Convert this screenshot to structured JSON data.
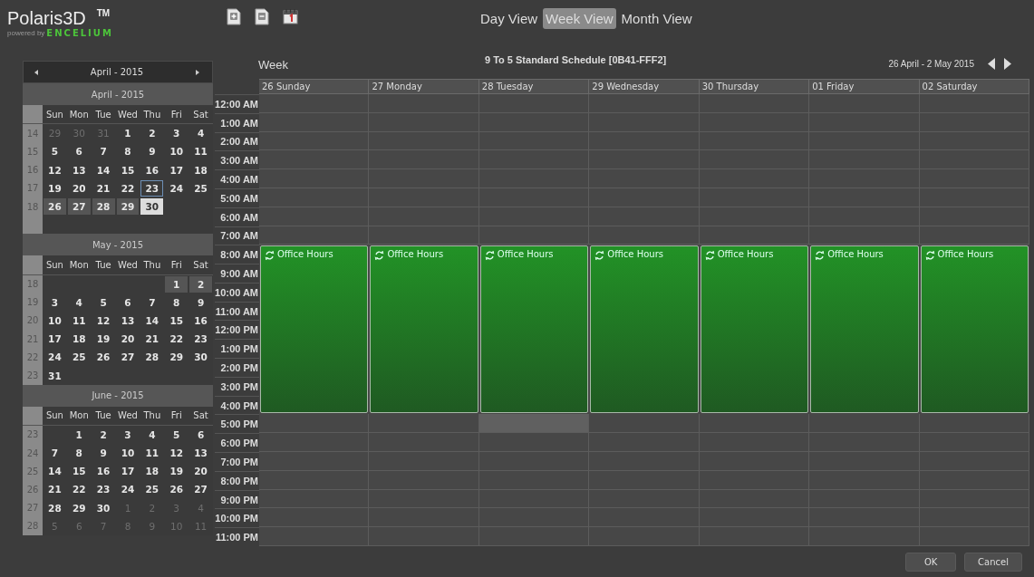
{
  "app": {
    "name": "Polaris3D",
    "trademark": "TM",
    "powered_by": "powered by",
    "brand": "ENCELIUM"
  },
  "views": [
    {
      "label": "Day View",
      "selected": false
    },
    {
      "label": "Week View",
      "selected": true
    },
    {
      "label": "Month View",
      "selected": false
    }
  ],
  "mini_calendar": {
    "title": "April - 2015",
    "months": [
      {
        "title": "April - 2015",
        "weekdays": [
          "Sun",
          "Mon",
          "Tue",
          "Wed",
          "Thu",
          "Fri",
          "Sat"
        ],
        "weeks": [
          {
            "number": "14",
            "days": [
              {
                "day": "29",
                "kind": "other"
              },
              {
                "day": "30",
                "kind": "other"
              },
              {
                "day": "31",
                "kind": "other"
              },
              {
                "day": "1",
                "kind": "normal"
              },
              {
                "day": "2",
                "kind": "normal"
              },
              {
                "day": "3",
                "kind": "normal"
              },
              {
                "day": "4",
                "kind": "normal"
              }
            ]
          },
          {
            "number": "15",
            "days": [
              {
                "day": "5",
                "kind": "normal"
              },
              {
                "day": "6",
                "kind": "normal"
              },
              {
                "day": "7",
                "kind": "normal"
              },
              {
                "day": "8",
                "kind": "normal"
              },
              {
                "day": "9",
                "kind": "normal"
              },
              {
                "day": "10",
                "kind": "normal"
              },
              {
                "day": "11",
                "kind": "normal"
              }
            ]
          },
          {
            "number": "16",
            "days": [
              {
                "day": "12",
                "kind": "normal"
              },
              {
                "day": "13",
                "kind": "normal"
              },
              {
                "day": "14",
                "kind": "normal"
              },
              {
                "day": "15",
                "kind": "normal"
              },
              {
                "day": "16",
                "kind": "normal"
              },
              {
                "day": "17",
                "kind": "normal"
              },
              {
                "day": "18",
                "kind": "normal"
              }
            ]
          },
          {
            "number": "17",
            "days": [
              {
                "day": "19",
                "kind": "normal"
              },
              {
                "day": "20",
                "kind": "normal"
              },
              {
                "day": "21",
                "kind": "normal"
              },
              {
                "day": "22",
                "kind": "normal"
              },
              {
                "day": "23",
                "kind": "today"
              },
              {
                "day": "24",
                "kind": "normal"
              },
              {
                "day": "25",
                "kind": "normal"
              }
            ]
          },
          {
            "number": "18",
            "days": [
              {
                "day": "26",
                "kind": "week"
              },
              {
                "day": "27",
                "kind": "week"
              },
              {
                "day": "28",
                "kind": "week"
              },
              {
                "day": "29",
                "kind": "week"
              },
              {
                "day": "30",
                "kind": "selected"
              },
              {
                "kind": "blank"
              },
              {
                "kind": "blank"
              }
            ]
          }
        ]
      },
      {
        "title": "May - 2015",
        "weekdays": [
          "Sun",
          "Mon",
          "Tue",
          "Wed",
          "Thu",
          "Fri",
          "Sat"
        ],
        "weeks": [
          {
            "number": "18",
            "days": [
              {
                "kind": "blank"
              },
              {
                "kind": "blank"
              },
              {
                "kind": "blank"
              },
              {
                "kind": "blank"
              },
              {
                "kind": "blank"
              },
              {
                "day": "1",
                "kind": "week"
              },
              {
                "day": "2",
                "kind": "week"
              }
            ]
          },
          {
            "number": "19",
            "days": [
              {
                "day": "3",
                "kind": "normal"
              },
              {
                "day": "4",
                "kind": "normal"
              },
              {
                "day": "5",
                "kind": "normal"
              },
              {
                "day": "6",
                "kind": "normal"
              },
              {
                "day": "7",
                "kind": "normal"
              },
              {
                "day": "8",
                "kind": "normal"
              },
              {
                "day": "9",
                "kind": "normal"
              }
            ]
          },
          {
            "number": "20",
            "days": [
              {
                "day": "10",
                "kind": "normal"
              },
              {
                "day": "11",
                "kind": "normal"
              },
              {
                "day": "12",
                "kind": "normal"
              },
              {
                "day": "13",
                "kind": "normal"
              },
              {
                "day": "14",
                "kind": "normal"
              },
              {
                "day": "15",
                "kind": "normal"
              },
              {
                "day": "16",
                "kind": "normal"
              }
            ]
          },
          {
            "number": "21",
            "days": [
              {
                "day": "17",
                "kind": "normal"
              },
              {
                "day": "18",
                "kind": "normal"
              },
              {
                "day": "19",
                "kind": "normal"
              },
              {
                "day": "20",
                "kind": "normal"
              },
              {
                "day": "21",
                "kind": "normal"
              },
              {
                "day": "22",
                "kind": "normal"
              },
              {
                "day": "23",
                "kind": "normal"
              }
            ]
          },
          {
            "number": "22",
            "days": [
              {
                "day": "24",
                "kind": "normal"
              },
              {
                "day": "25",
                "kind": "normal"
              },
              {
                "day": "26",
                "kind": "normal"
              },
              {
                "day": "27",
                "kind": "normal"
              },
              {
                "day": "28",
                "kind": "normal"
              },
              {
                "day": "29",
                "kind": "normal"
              },
              {
                "day": "30",
                "kind": "normal"
              }
            ]
          },
          {
            "number": "23",
            "days": [
              {
                "day": "31",
                "kind": "normal"
              },
              {
                "kind": "blank"
              },
              {
                "kind": "blank"
              },
              {
                "kind": "blank"
              },
              {
                "kind": "blank"
              },
              {
                "kind": "blank"
              },
              {
                "kind": "blank"
              }
            ]
          }
        ]
      },
      {
        "title": "June - 2015",
        "weekdays": [
          "Sun",
          "Mon",
          "Tue",
          "Wed",
          "Thu",
          "Fri",
          "Sat"
        ],
        "weeks": [
          {
            "number": "23",
            "days": [
              {
                "kind": "blank"
              },
              {
                "day": "1",
                "kind": "normal"
              },
              {
                "day": "2",
                "kind": "normal"
              },
              {
                "day": "3",
                "kind": "normal"
              },
              {
                "day": "4",
                "kind": "normal"
              },
              {
                "day": "5",
                "kind": "normal"
              },
              {
                "day": "6",
                "kind": "normal"
              }
            ]
          },
          {
            "number": "24",
            "days": [
              {
                "day": "7",
                "kind": "normal"
              },
              {
                "day": "8",
                "kind": "normal"
              },
              {
                "day": "9",
                "kind": "normal"
              },
              {
                "day": "10",
                "kind": "normal"
              },
              {
                "day": "11",
                "kind": "normal"
              },
              {
                "day": "12",
                "kind": "normal"
              },
              {
                "day": "13",
                "kind": "normal"
              }
            ]
          },
          {
            "number": "25",
            "days": [
              {
                "day": "14",
                "kind": "normal"
              },
              {
                "day": "15",
                "kind": "normal"
              },
              {
                "day": "16",
                "kind": "normal"
              },
              {
                "day": "17",
                "kind": "normal"
              },
              {
                "day": "18",
                "kind": "normal"
              },
              {
                "day": "19",
                "kind": "normal"
              },
              {
                "day": "20",
                "kind": "normal"
              }
            ]
          },
          {
            "number": "26",
            "days": [
              {
                "day": "21",
                "kind": "normal"
              },
              {
                "day": "22",
                "kind": "normal"
              },
              {
                "day": "23",
                "kind": "normal"
              },
              {
                "day": "24",
                "kind": "normal"
              },
              {
                "day": "25",
                "kind": "normal"
              },
              {
                "day": "26",
                "kind": "normal"
              },
              {
                "day": "27",
                "kind": "normal"
              }
            ]
          },
          {
            "number": "27",
            "days": [
              {
                "day": "28",
                "kind": "normal"
              },
              {
                "day": "29",
                "kind": "normal"
              },
              {
                "day": "30",
                "kind": "normal"
              },
              {
                "day": "1",
                "kind": "other"
              },
              {
                "day": "2",
                "kind": "other"
              },
              {
                "day": "3",
                "kind": "other"
              },
              {
                "day": "4",
                "kind": "other"
              }
            ]
          },
          {
            "number": "28",
            "days": [
              {
                "day": "5",
                "kind": "other"
              },
              {
                "day": "6",
                "kind": "other"
              },
              {
                "day": "7",
                "kind": "other"
              },
              {
                "day": "8",
                "kind": "other"
              },
              {
                "day": "9",
                "kind": "other"
              },
              {
                "day": "10",
                "kind": "other"
              },
              {
                "day": "11",
                "kind": "other"
              }
            ]
          }
        ]
      }
    ]
  },
  "schedule": {
    "view_label": "Week",
    "title": "9 To 5 Standard Schedule [0B41-FFF2]",
    "date_range": "26 April - 2 May 2015",
    "hours": [
      "12:00 AM",
      "1:00 AM",
      "2:00 AM",
      "3:00 AM",
      "4:00 AM",
      "5:00 AM",
      "6:00 AM",
      "7:00 AM",
      "8:00 AM",
      "9:00 AM",
      "10:00 AM",
      "11:00 AM",
      "12:00 PM",
      "1:00 PM",
      "2:00 PM",
      "3:00 PM",
      "4:00 PM",
      "5:00 PM",
      "6:00 PM",
      "7:00 PM",
      "8:00 PM",
      "9:00 PM",
      "10:00 PM",
      "11:00 PM"
    ],
    "days": [
      {
        "label": "26 Sunday",
        "event": {
          "title": "Office Hours"
        },
        "slots": [
          {
            "kind": "free"
          },
          {
            "kind": "free"
          },
          {
            "kind": "free"
          },
          {
            "kind": "free"
          },
          {
            "kind": "free"
          },
          {
            "kind": "free"
          },
          {
            "kind": "free"
          },
          {
            "kind": "free"
          },
          {
            "kind": "event"
          },
          {
            "kind": "event"
          },
          {
            "kind": "event"
          },
          {
            "kind": "event"
          },
          {
            "kind": "event"
          },
          {
            "kind": "event"
          },
          {
            "kind": "event"
          },
          {
            "kind": "event"
          },
          {
            "kind": "event"
          },
          {
            "kind": "free"
          },
          {
            "kind": "free"
          },
          {
            "kind": "free"
          },
          {
            "kind": "free"
          },
          {
            "kind": "free"
          },
          {
            "kind": "free"
          },
          {
            "kind": "free"
          }
        ]
      },
      {
        "label": "27 Monday",
        "event": {
          "title": "Office Hours"
        },
        "slots": [
          {
            "kind": "free"
          },
          {
            "kind": "free"
          },
          {
            "kind": "free"
          },
          {
            "kind": "free"
          },
          {
            "kind": "free"
          },
          {
            "kind": "free"
          },
          {
            "kind": "free"
          },
          {
            "kind": "free"
          },
          {
            "kind": "event"
          },
          {
            "kind": "event"
          },
          {
            "kind": "event"
          },
          {
            "kind": "event"
          },
          {
            "kind": "event"
          },
          {
            "kind": "event"
          },
          {
            "kind": "event"
          },
          {
            "kind": "event"
          },
          {
            "kind": "event"
          },
          {
            "kind": "free"
          },
          {
            "kind": "free"
          },
          {
            "kind": "free"
          },
          {
            "kind": "free"
          },
          {
            "kind": "free"
          },
          {
            "kind": "free"
          },
          {
            "kind": "free"
          }
        ]
      },
      {
        "label": "28 Tuesday",
        "event": {
          "title": "Office Hours"
        },
        "slots": [
          {
            "kind": "free"
          },
          {
            "kind": "free"
          },
          {
            "kind": "free"
          },
          {
            "kind": "free"
          },
          {
            "kind": "free"
          },
          {
            "kind": "free"
          },
          {
            "kind": "free"
          },
          {
            "kind": "free"
          },
          {
            "kind": "event"
          },
          {
            "kind": "event"
          },
          {
            "kind": "event"
          },
          {
            "kind": "event"
          },
          {
            "kind": "event"
          },
          {
            "kind": "event"
          },
          {
            "kind": "event"
          },
          {
            "kind": "event"
          },
          {
            "kind": "event"
          },
          {
            "kind": "selected"
          },
          {
            "kind": "free"
          },
          {
            "kind": "free"
          },
          {
            "kind": "free"
          },
          {
            "kind": "free"
          },
          {
            "kind": "free"
          },
          {
            "kind": "free"
          }
        ]
      },
      {
        "label": "29 Wednesday",
        "event": {
          "title": "Office Hours"
        },
        "slots": [
          {
            "kind": "free"
          },
          {
            "kind": "free"
          },
          {
            "kind": "free"
          },
          {
            "kind": "free"
          },
          {
            "kind": "free"
          },
          {
            "kind": "free"
          },
          {
            "kind": "free"
          },
          {
            "kind": "free"
          },
          {
            "kind": "event"
          },
          {
            "kind": "event"
          },
          {
            "kind": "event"
          },
          {
            "kind": "event"
          },
          {
            "kind": "event"
          },
          {
            "kind": "event"
          },
          {
            "kind": "event"
          },
          {
            "kind": "event"
          },
          {
            "kind": "event"
          },
          {
            "kind": "free"
          },
          {
            "kind": "free"
          },
          {
            "kind": "free"
          },
          {
            "kind": "free"
          },
          {
            "kind": "free"
          },
          {
            "kind": "free"
          },
          {
            "kind": "free"
          }
        ]
      },
      {
        "label": "30 Thursday",
        "event": {
          "title": "Office Hours"
        },
        "slots": [
          {
            "kind": "free"
          },
          {
            "kind": "free"
          },
          {
            "kind": "free"
          },
          {
            "kind": "free"
          },
          {
            "kind": "free"
          },
          {
            "kind": "free"
          },
          {
            "kind": "free"
          },
          {
            "kind": "free"
          },
          {
            "kind": "event"
          },
          {
            "kind": "event"
          },
          {
            "kind": "event"
          },
          {
            "kind": "event"
          },
          {
            "kind": "event"
          },
          {
            "kind": "event"
          },
          {
            "kind": "event"
          },
          {
            "kind": "event"
          },
          {
            "kind": "event"
          },
          {
            "kind": "free"
          },
          {
            "kind": "free"
          },
          {
            "kind": "free"
          },
          {
            "kind": "free"
          },
          {
            "kind": "free"
          },
          {
            "kind": "free"
          },
          {
            "kind": "free"
          }
        ]
      },
      {
        "label": "01 Friday",
        "event": {
          "title": "Office Hours"
        },
        "slots": [
          {
            "kind": "free"
          },
          {
            "kind": "free"
          },
          {
            "kind": "free"
          },
          {
            "kind": "free"
          },
          {
            "kind": "free"
          },
          {
            "kind": "free"
          },
          {
            "kind": "free"
          },
          {
            "kind": "free"
          },
          {
            "kind": "event"
          },
          {
            "kind": "event"
          },
          {
            "kind": "event"
          },
          {
            "kind": "event"
          },
          {
            "kind": "event"
          },
          {
            "kind": "event"
          },
          {
            "kind": "event"
          },
          {
            "kind": "event"
          },
          {
            "kind": "event"
          },
          {
            "kind": "free"
          },
          {
            "kind": "free"
          },
          {
            "kind": "free"
          },
          {
            "kind": "free"
          },
          {
            "kind": "free"
          },
          {
            "kind": "free"
          },
          {
            "kind": "free"
          }
        ]
      },
      {
        "label": "02 Saturday",
        "event": {
          "title": "Office Hours"
        },
        "slots": [
          {
            "kind": "free"
          },
          {
            "kind": "free"
          },
          {
            "kind": "free"
          },
          {
            "kind": "free"
          },
          {
            "kind": "free"
          },
          {
            "kind": "free"
          },
          {
            "kind": "free"
          },
          {
            "kind": "free"
          },
          {
            "kind": "event"
          },
          {
            "kind": "event"
          },
          {
            "kind": "event"
          },
          {
            "kind": "event"
          },
          {
            "kind": "event"
          },
          {
            "kind": "event"
          },
          {
            "kind": "event"
          },
          {
            "kind": "event"
          },
          {
            "kind": "event"
          },
          {
            "kind": "free"
          },
          {
            "kind": "free"
          },
          {
            "kind": "free"
          },
          {
            "kind": "free"
          },
          {
            "kind": "free"
          },
          {
            "kind": "free"
          },
          {
            "kind": "free"
          }
        ]
      }
    ]
  },
  "buttons": [
    "OK",
    "Cancel"
  ]
}
